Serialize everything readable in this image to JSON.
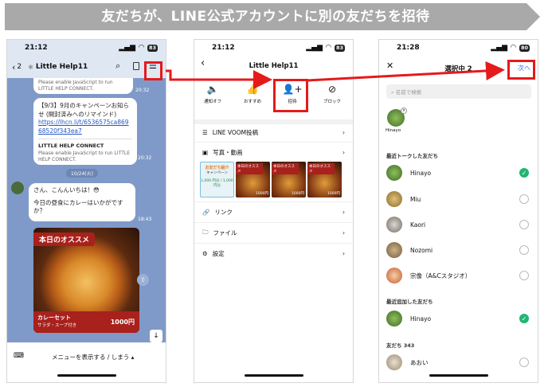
{
  "banner": "友だちが、LINE公式アカウントに別の友だちを招待",
  "phone1": {
    "time": "21:12",
    "battery": "83",
    "back_count": "2",
    "account": "Little Help11",
    "msg_enable": "Please enable JavaScript to run LITTLE HELP CONNECT.",
    "msg_time1": "20:32",
    "campaign_text": "【9/3】9月のキャンペーンお知らせ (開封済みへのリマインド)",
    "link": "https://lhcn.li/t/6536575ca86968520f343ea7",
    "connect_title": "LITTLE HELP CONNECT",
    "connect_body": "Please enable JavaScript to run LITTLE HELP CONNECT.",
    "msg_time2": "20:32",
    "date": "10/24(火)",
    "greeting1": "さん、こんんいちは！😳",
    "greeting2": "今日の昼食にカレーはいかがですか？",
    "msg_time3": "18:43",
    "card_banner": "本日のオススメ",
    "card_name": "カレーセット",
    "card_sub": "サラダ・スープ付き",
    "card_price": "1000円",
    "menu_label": "メニューを表示する / しまう ▴"
  },
  "phone2": {
    "time": "21:12",
    "battery": "83",
    "title": "Little Help11",
    "actions": [
      "通知オフ",
      "おすすめ",
      "招待",
      "ブロック"
    ],
    "voom": "LINE VOOM投稿",
    "photos": "写真・動画",
    "thumb1_top": "お友だち紹介",
    "thumb1_sub": "キャンペーン",
    "thumb1_prices": "1,000 円分 / 1,000 円分",
    "thumb_label": "本日のオススメ",
    "thumb_price": "1000円",
    "links": "リンク",
    "files": "ファイル",
    "settings": "設定"
  },
  "phone3": {
    "time": "21:28",
    "battery": "80",
    "title": "選択中 2",
    "next": "次へ",
    "search_placeholder": "名前で検索",
    "selected_name": "Hinayo",
    "recent_label": "最近トークした友だち",
    "recent": [
      "Hinayo",
      "Miu",
      "Kaori",
      "Nozomi",
      "宗像（A&Cスタジオ）"
    ],
    "added_label": "最近追加した友だち",
    "added": [
      "Hinayo"
    ],
    "friends_label": "友だち 343",
    "friends": [
      "あおい"
    ]
  },
  "colors": {
    "highlight": "#e51a1a",
    "line_green": "#22b573",
    "chat_bg": "#7f9ac8",
    "next_blue": "#3478f6"
  }
}
